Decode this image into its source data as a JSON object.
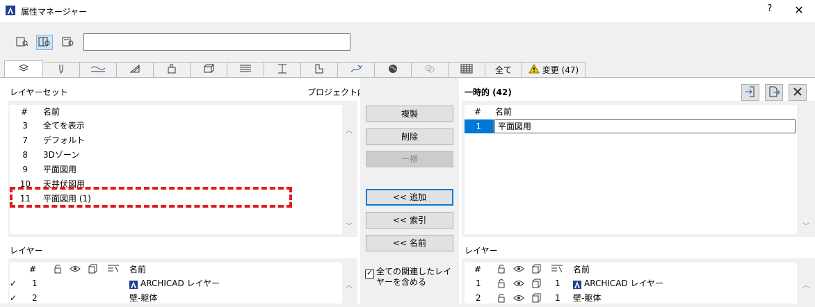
{
  "window": {
    "title": "属性マネージャー",
    "help": "?",
    "close": "✕"
  },
  "toolbar": {
    "search_placeholder": "",
    "views": [
      "list-view-icon",
      "split-view-icon",
      "detail-view-icon"
    ],
    "selected_view": 1
  },
  "tabs": {
    "icons": [
      "layers-icon",
      "pen-icon",
      "line-type-icon",
      "fill-icon",
      "building-material-icon",
      "composite-icon",
      "profile-icon",
      "zone-icon",
      "markup-icon",
      "surface-icon",
      "globe-icon",
      "link-icon",
      "table-icon"
    ],
    "all_label": "全て",
    "changes_label": "変更 (47)"
  },
  "left": {
    "layer_sets_label": "レイヤーセット",
    "in_project_label": "プロジェクト内",
    "header": {
      "num": "#",
      "name": "名前"
    },
    "rows": [
      {
        "num": "3",
        "name": "全てを表示"
      },
      {
        "num": "7",
        "name": "デフォルト"
      },
      {
        "num": "8",
        "name": "3Dゾーン"
      },
      {
        "num": "9",
        "name": "平面図用"
      },
      {
        "num": "10",
        "name": "天井伏図用"
      },
      {
        "num": "11",
        "name": "平面図用 (1)"
      }
    ],
    "layers_label": "レイヤー",
    "layers_header": {
      "num": "#",
      "name": "名前"
    },
    "layers_rows": [
      {
        "check": "✓",
        "num": "1",
        "name": "ARCHICAD レイヤー"
      },
      {
        "check": "✓",
        "num": "2",
        "name": "壁-躯体"
      }
    ]
  },
  "middle": {
    "duplicate": "複製",
    "delete": "削除",
    "sweep": "一掃",
    "add": "<< 追加",
    "index": "<< 索引",
    "name": "<< 名前",
    "include_related_line1": "全ての関連したレイ",
    "include_related_line2": "ヤーを含める"
  },
  "right": {
    "title": "一時的 (42)",
    "header": {
      "num": "#",
      "name": "名前"
    },
    "rows": [
      {
        "num": "1",
        "name": "平面図用"
      }
    ],
    "layers_label": "レイヤー",
    "layers_header": {
      "num": "#",
      "name": "名前"
    },
    "layers_rows": [
      {
        "num": "1",
        "val": "1",
        "name": "ARCHICAD レイヤー"
      },
      {
        "num": "2",
        "val": "1",
        "name": "壁-躯体"
      }
    ]
  },
  "colors": {
    "accent": "#0078d7",
    "highlight": "#e21b1b",
    "selection": "#cce4f7"
  }
}
